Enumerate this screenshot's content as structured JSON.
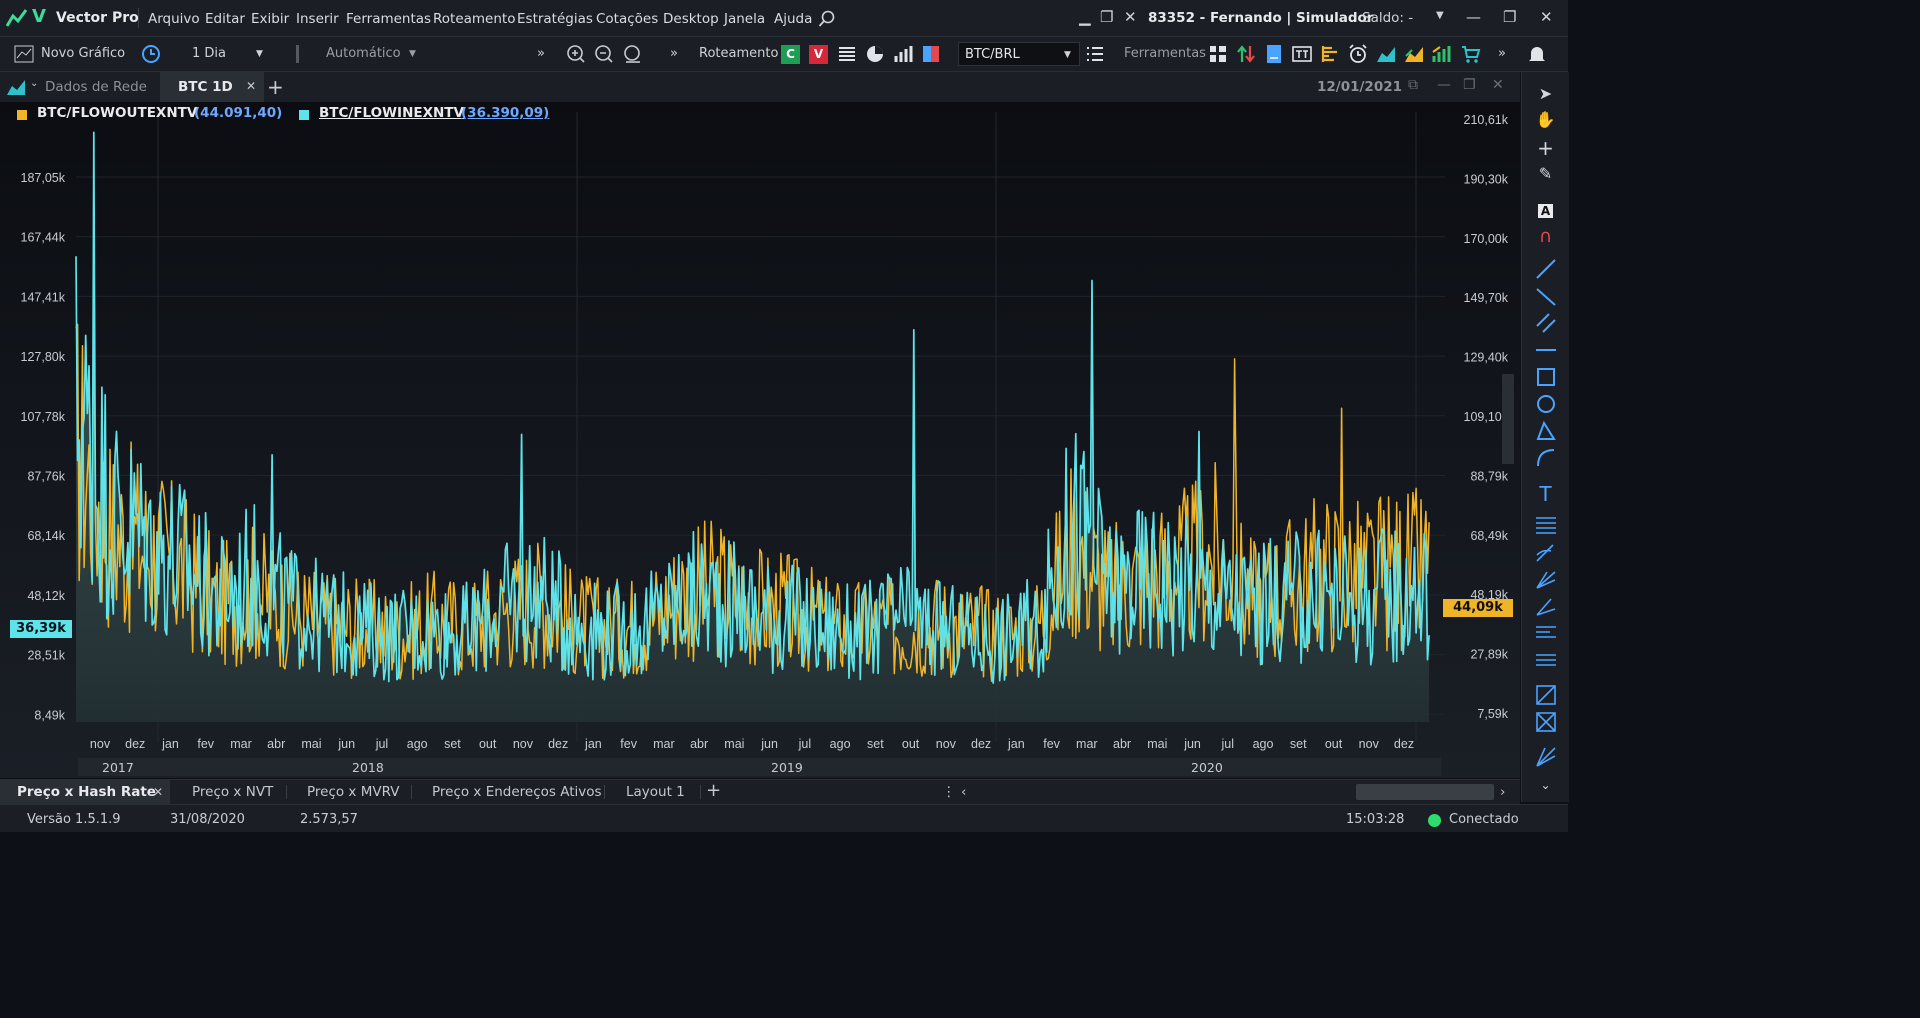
{
  "app": {
    "title": "Vector Pro",
    "account": "83352 - Fernando | Simulador",
    "balance": "Saldo: -"
  },
  "menu": [
    "Arquivo",
    "Editar",
    "Exibir",
    "Inserir",
    "Ferramentas",
    "Roteamento",
    "Estratégias",
    "Cotações",
    "Desktop",
    "Janela",
    "Ajuda"
  ],
  "toolbar": {
    "new_chart": "Novo Gráfico",
    "period": "1 Dia",
    "mode": "Automático",
    "routing": "Roteamento",
    "buy": "C",
    "sell": "V",
    "symbol": "BTC/BRL",
    "tools": "Ferramentas"
  },
  "tabs": {
    "data_tab": "Dados de Rede",
    "chart_tab": "BTC 1D",
    "date": "12/01/2021"
  },
  "legend": [
    {
      "name": "BTC/FLOWOUTEXNTV",
      "value": "(44.091,40)",
      "color": "#f0b429"
    },
    {
      "name": "BTC/FLOWINEXNTV",
      "value": "(36.390,09)",
      "color": "#5fe3e8"
    }
  ],
  "chart_data": {
    "type": "line",
    "x": [
      "2017-11",
      "2017-12",
      "2018-01",
      "2018-02",
      "2018-03",
      "2018-04",
      "2018-05",
      "2018-06",
      "2018-07",
      "2018-08",
      "2018-09",
      "2018-10",
      "2018-11",
      "2018-12",
      "2019-01",
      "2019-02",
      "2019-03",
      "2019-04",
      "2019-05",
      "2019-06",
      "2019-07",
      "2019-08",
      "2019-09",
      "2019-10",
      "2019-11",
      "2019-12",
      "2020-01",
      "2020-02",
      "2020-03",
      "2020-04",
      "2020-05",
      "2020-06",
      "2020-07",
      "2020-08",
      "2020-09",
      "2020-10",
      "2020-11",
      "2020-12"
    ],
    "series": [
      {
        "name": "BTC/FLOWOUTEXNTV",
        "color": "#f0b429",
        "values": [
          95000,
          65000,
          60000,
          52000,
          40000,
          45000,
          38000,
          34000,
          33000,
          30000,
          34000,
          33000,
          38000,
          42000,
          34000,
          32000,
          35000,
          44000,
          46000,
          40000,
          38000,
          33000,
          32000,
          32000,
          34000,
          32000,
          30000,
          34000,
          62000,
          44000,
          50000,
          52000,
          58000,
          42000,
          46000,
          52000,
          50000,
          52000
        ]
      },
      {
        "name": "BTC/FLOWINEXNTV",
        "color": "#5fe3e8",
        "values": [
          110000,
          72000,
          62000,
          55000,
          42000,
          50000,
          40000,
          35000,
          32000,
          30000,
          32000,
          31000,
          40000,
          44000,
          33000,
          31000,
          33000,
          42000,
          43000,
          38000,
          36000,
          32000,
          30000,
          36000,
          32000,
          30000,
          29000,
          33000,
          70000,
          46000,
          50000,
          48000,
          44000,
          40000,
          42000,
          44000,
          42000,
          45000
        ]
      }
    ],
    "peaks": [
      {
        "x": "2017-11",
        "outflow": 160000,
        "inflow": 203000
      },
      {
        "x": "2018-04",
        "inflow": 92000
      },
      {
        "x": "2018-11",
        "inflow": 99000
      },
      {
        "x": "2019-10",
        "inflow": 135000
      },
      {
        "x": "2020-03",
        "inflow": 152000
      },
      {
        "x": "2020-06",
        "inflow": 100000
      },
      {
        "x": "2020-07",
        "outflow": 125000
      },
      {
        "x": "2020-10",
        "outflow": 108000
      }
    ],
    "left_axis_ticks": [
      "187,05k",
      "167,44k",
      "147,41k",
      "127,80k",
      "107,78k",
      "87,76k",
      "68,14k",
      "48,12k",
      "28,51k",
      "8,49k"
    ],
    "right_axis_ticks": [
      "210,61k",
      "190,30k",
      "170,00k",
      "149,70k",
      "129,40k",
      "109,10k",
      "88,79k",
      "68,49k",
      "48,19k",
      "27,89k",
      "7,59k"
    ],
    "left_current": "36,39k",
    "right_current": "44,09k",
    "month_labels": [
      "nov",
      "dez",
      "jan",
      "fev",
      "mar",
      "abr",
      "mai",
      "jun",
      "jul",
      "ago",
      "set",
      "out",
      "nov",
      "dez",
      "jan",
      "fev",
      "mar",
      "abr",
      "mai",
      "jun",
      "jul",
      "ago",
      "set",
      "out",
      "nov",
      "dez",
      "jan",
      "fev",
      "mar",
      "abr",
      "mai",
      "jun",
      "jul",
      "ago",
      "set",
      "out",
      "nov",
      "dez"
    ],
    "year_labels": [
      "2017",
      "2018",
      "2019",
      "2020"
    ],
    "ylim_left": [
      0,
      210000
    ],
    "ylim_right": [
      0,
      210610
    ]
  },
  "layout_tabs": [
    "Preço x Hash Rate",
    "Preço x NVT",
    "Preço x MVRV",
    "Preço x Endereços Ativos",
    "Layout 1"
  ],
  "status": {
    "version": "Versão 1.5.1.9",
    "date": "31/08/2020",
    "value": "2.573,57",
    "time": "15:03:28",
    "connection": "Conectado"
  }
}
